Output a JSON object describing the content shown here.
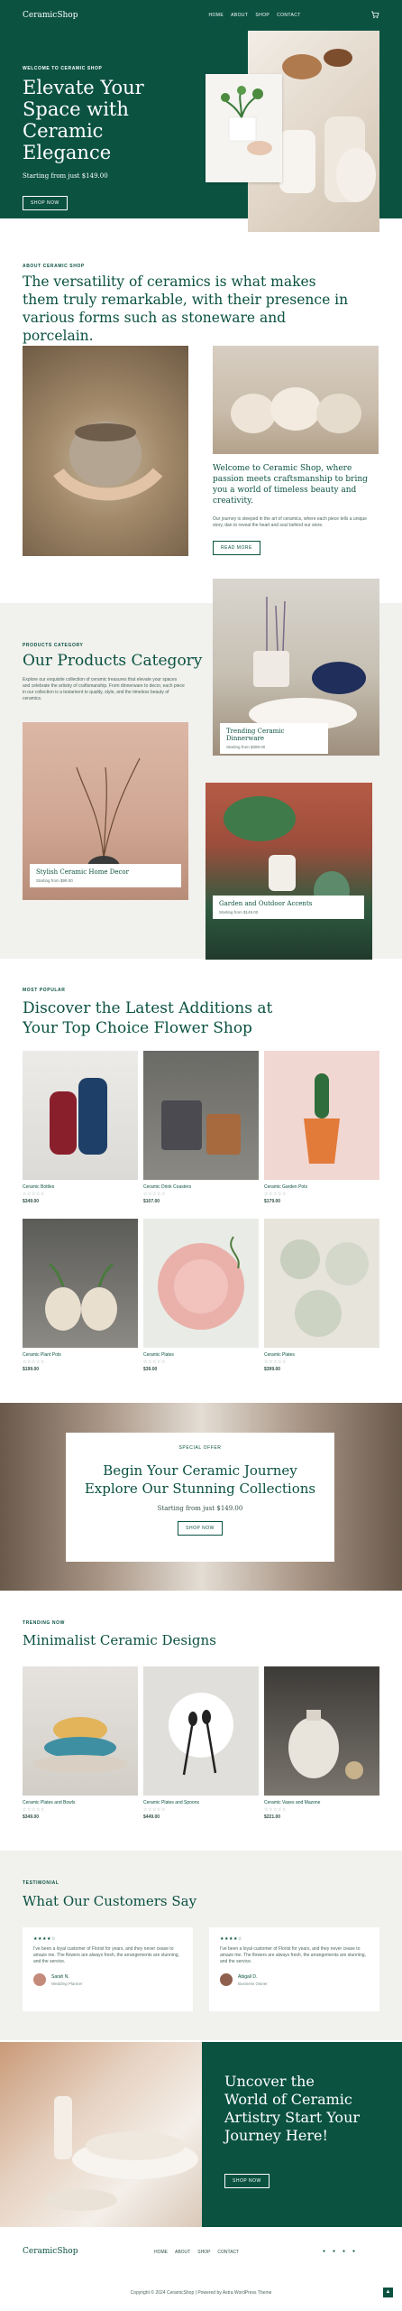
{
  "header": {
    "logo": "CeramicShop",
    "nav": [
      "HOME",
      "ABOUT",
      "SHOP",
      "CONTACT"
    ]
  },
  "hero": {
    "label": "WELCOME TO CERAMIC SHOP",
    "title": "Elevate Your Space with Ceramic Elegance",
    "price_line": "Starting from just $149.00",
    "button": "SHOP NOW"
  },
  "about": {
    "label": "ABOUT CERAMIC SHOP",
    "heading": "The versatility of ceramics is what makes them truly remarkable, with their presence in various forms such as stoneware and porcelain.",
    "card_title": "Welcome to Ceramic Shop, where passion meets craftsmanship to bring you a world of timeless beauty and creativity.",
    "card_desc": "Our journey is steeped in the art of ceramics, where each piece tells a unique story, dan to reveal the heart and soul behind our store.",
    "button": "READ MORE"
  },
  "category": {
    "label": "PRODUCTS CATEGORY",
    "heading": "Our Products Category",
    "desc": "Explore our exquisite collection of ceramic treasures that elevate your spaces and celebrate the artistry of craftsmanship. From dinnerware to decor, each piece in our collection is a testament to quality, style, and the timeless beauty of ceramics.",
    "cards": [
      {
        "title": "Trending Ceramic Dinnerware",
        "sub": "Starting from $399.00"
      },
      {
        "title": "Stylish Ceramic Home Decor",
        "sub": "Starting from $99.00"
      },
      {
        "title": "Garden and Outdoor Accents",
        "sub": "Starting from $149.00"
      }
    ]
  },
  "popular": {
    "label": "MOST POPULAR",
    "heading": "Discover the Latest Additions at Your Top Choice Flower Shop",
    "products": [
      {
        "name": "Ceramic Bottles",
        "price": "$349.00",
        "stars": "☆☆☆☆☆"
      },
      {
        "name": "Ceramic Drink Coasters",
        "price": "$107.00",
        "stars": "☆☆☆☆☆"
      },
      {
        "name": "Ceramic Garden Pots",
        "price": "$179.00",
        "stars": "☆☆☆☆☆"
      },
      {
        "name": "Ceramic Plant Pots",
        "price": "$199.00",
        "stars": "☆☆☆☆☆"
      },
      {
        "name": "Ceramic Plates",
        "price": "$39.00",
        "stars": "☆☆☆☆☆"
      },
      {
        "name": "Ceramic Plates",
        "price": "$399.00",
        "stars": "☆☆☆☆☆"
      }
    ]
  },
  "banner": {
    "label": "SPECIAL OFFER",
    "title": "Begin Your Ceramic Journey Explore Our Stunning Collections",
    "sub": "Starting from just $149.00",
    "button": "SHOP NOW"
  },
  "trending": {
    "label": "TRENDING NOW",
    "heading": "Minimalist Ceramic Designs",
    "products": [
      {
        "name": "Ceramic Plates and Bowls",
        "price": "$349.00",
        "stars": "☆☆☆☆☆"
      },
      {
        "name": "Ceramic Plates and Spoons",
        "price": "$449.00",
        "stars": "☆☆☆☆☆"
      },
      {
        "name": "Ceramic Vases and Mazone",
        "price": "$221.00",
        "stars": "☆☆☆☆☆"
      }
    ]
  },
  "testimonials": {
    "label": "TESTIMONIAL",
    "heading": "What Our Customers Say",
    "items": [
      {
        "stars": "★★★★☆",
        "quote": "I've been a loyal customer of Florist for years, and they never cease to amaze me. The flowers are always fresh, the arrangements are stunning, and the service.",
        "name": "Sarah N.",
        "role": "Wedding Planner"
      },
      {
        "stars": "★★★★☆",
        "quote": "I've been a loyal customer of Florist for years, and they never cease to amaze me. The flowers are always fresh, the arrangements are stunning, and the service.",
        "name": "Abigail D.",
        "role": "Business Owner"
      }
    ]
  },
  "cta": {
    "title": "Uncover the World of Ceramic Artistry Start Your Journey Here!",
    "button": "SHOP NOW"
  },
  "footer": {
    "logo": "CeramicShop",
    "nav": [
      "HOME",
      "ABOUT",
      "SHOP",
      "CONTACT"
    ],
    "copyright": "Copyright © 2024 CeramicShop | Powered by Astra WordPress Theme"
  },
  "colors": {
    "brand": "#0b5241",
    "section_bg": "#f1f1ee"
  }
}
